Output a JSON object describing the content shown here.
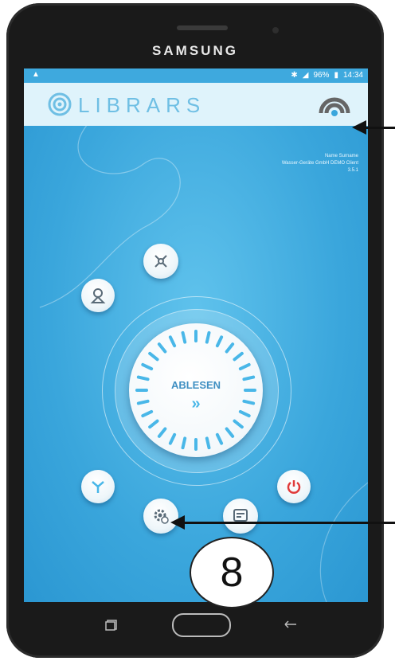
{
  "device": {
    "brand": "SAMSUNG"
  },
  "status_bar": {
    "battery": "96%",
    "time": "14:34"
  },
  "app": {
    "logo_text": "LIBRARS",
    "user_name": "Name Surname",
    "company": "Wasser-Geräte GmbH DEMO Client",
    "version": "3.5.1"
  },
  "main": {
    "read_button_label": "ABLESEN",
    "read_button_arrows": "»"
  },
  "annotation": {
    "callout_number": "8"
  },
  "colors": {
    "accent": "#3aa6dc",
    "appbar": "#dff3fb",
    "power": "#e03a3a"
  }
}
